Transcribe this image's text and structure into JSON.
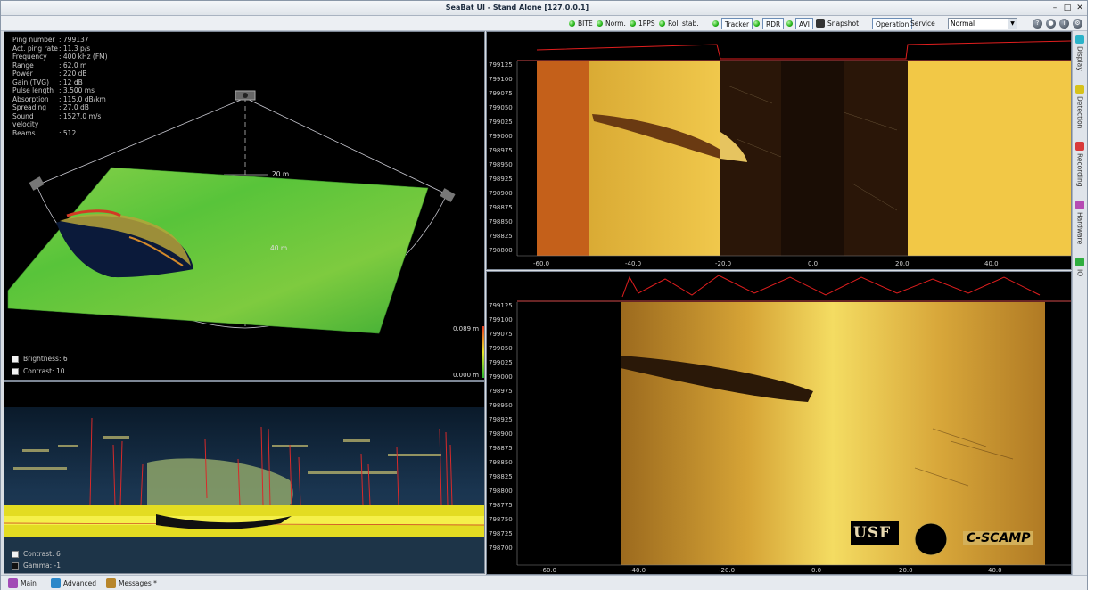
{
  "window": {
    "title": "SeaBat UI - Stand Alone [127.0.0.1]",
    "minimize": "–",
    "maximize": "□",
    "close": "✕"
  },
  "toolbar": {
    "indicators": [
      {
        "label": "BITE"
      },
      {
        "label": "Norm."
      },
      {
        "label": "1PPS"
      },
      {
        "label": "Roll stab."
      },
      {
        "label": "Tracker"
      },
      {
        "label": "RDR"
      },
      {
        "label": "AVI"
      }
    ],
    "snapshot": "Snapshot",
    "operation": "Operation",
    "service": "Service",
    "mode": "Normal",
    "help_icons": [
      "?",
      "●",
      "i",
      "⚙"
    ]
  },
  "sonar_info": [
    {
      "key": "Ping number",
      "value": ": 799137"
    },
    {
      "key": "Act. ping rate",
      "value": ": 11.3 p/s"
    },
    {
      "key": "Frequency",
      "value": ": 400 kHz (FM)"
    },
    {
      "key": "Range",
      "value": ": 62.0 m"
    },
    {
      "key": "Power",
      "value": ": 220 dB"
    },
    {
      "key": "Gain (TVG)",
      "value": ": 12 dB"
    },
    {
      "key": "Pulse length",
      "value": ": 3.500 ms"
    },
    {
      "key": "Absorption",
      "value": ": 115.0 dB/km"
    },
    {
      "key": "Spreading",
      "value": ": 27.0 dB"
    },
    {
      "key": "Sound velocity",
      "value": ": 1527.0 m/s"
    },
    {
      "key": "Beams",
      "value": ": 512"
    }
  ],
  "view3d": {
    "range_label": "20 m",
    "range_label_2": "40 m",
    "color_max": "0.089 m",
    "color_min": "0.000 m",
    "brightness": "Brightness: 6",
    "contrast": "Contrast: 10"
  },
  "wedge": {
    "contrast": "Contrast: 6",
    "gamma": "Gamma: -1"
  },
  "sidescan_top": {
    "ylabels": [
      "799125",
      "799100",
      "799075",
      "799050",
      "799025",
      "799000",
      "798975",
      "798950",
      "798925",
      "798900",
      "798875",
      "798850",
      "798825",
      "798800"
    ],
    "xlabels": [
      "-60.0",
      "-40.0",
      "-20.0",
      "0.0",
      "20.0",
      "40.0"
    ]
  },
  "sidescan_bottom": {
    "ylabels": [
      "799125",
      "799100",
      "799075",
      "799050",
      "799025",
      "799000",
      "798975",
      "798950",
      "798925",
      "798900",
      "798875",
      "798850",
      "798825",
      "798800",
      "798775",
      "798750",
      "798725",
      "798700"
    ],
    "xlabels": [
      "-60.0",
      "-40.0",
      "-20.0",
      "0.0",
      "20.0",
      "40.0"
    ]
  },
  "logos": {
    "usf": "USF",
    "cscamp": "C-SCAMP"
  },
  "side_tabs": [
    {
      "label": "Display",
      "color": "#2bb3c9"
    },
    {
      "label": "Detection",
      "color": "#d7c21b"
    },
    {
      "label": "Recording",
      "color": "#d93a3a"
    },
    {
      "label": "Hardware",
      "color": "#b64bb3"
    },
    {
      "label": "IO",
      "color": "#2fae3f"
    }
  ],
  "bottom_tabs": [
    {
      "label": "Main",
      "color": "#a24bb6"
    },
    {
      "label": "Advanced",
      "color": "#2c88c9"
    },
    {
      "label": "Messages *",
      "color": "#b8862b"
    }
  ]
}
